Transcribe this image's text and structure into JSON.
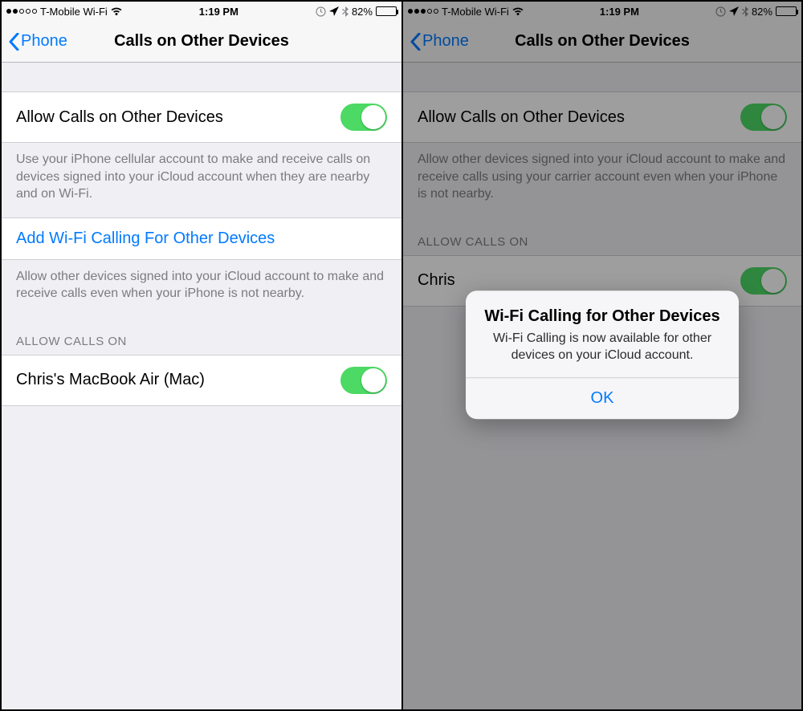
{
  "left": {
    "statusbar": {
      "signal_dots": 2,
      "carrier": "T-Mobile Wi-Fi",
      "time": "1:19 PM",
      "battery_pct": "82%",
      "battery_fill": 82
    },
    "navbar": {
      "back": "Phone",
      "title": "Calls on Other Devices"
    },
    "allow_label": "Allow Calls on Other Devices",
    "allow_footer": "Use your iPhone cellular account to make and receive calls on devices signed into your iCloud account when they are nearby and on Wi-Fi.",
    "add_wifi_label": "Add Wi-Fi Calling For Other Devices",
    "add_wifi_footer": "Allow other devices signed into your iCloud account to make and receive calls even when your iPhone is not nearby.",
    "section_header": "ALLOW CALLS ON",
    "device_name": "Chris's MacBook Air (Mac)"
  },
  "right": {
    "statusbar": {
      "signal_dots": 3,
      "carrier": "T-Mobile Wi-Fi",
      "time": "1:19 PM",
      "battery_pct": "82%",
      "battery_fill": 82
    },
    "navbar": {
      "back": "Phone",
      "title": "Calls on Other Devices"
    },
    "allow_label": "Allow Calls on Other Devices",
    "allow_footer": "Allow other devices signed into your iCloud account to make and receive calls using your carrier account even when your iPhone is not nearby.",
    "section_header": "ALLOW CALLS ON",
    "device_name_truncated": "Chris",
    "alert": {
      "title": "Wi-Fi Calling for Other Devices",
      "message": "Wi-Fi Calling is now available for other devices on your iCloud account.",
      "ok": "OK"
    }
  }
}
